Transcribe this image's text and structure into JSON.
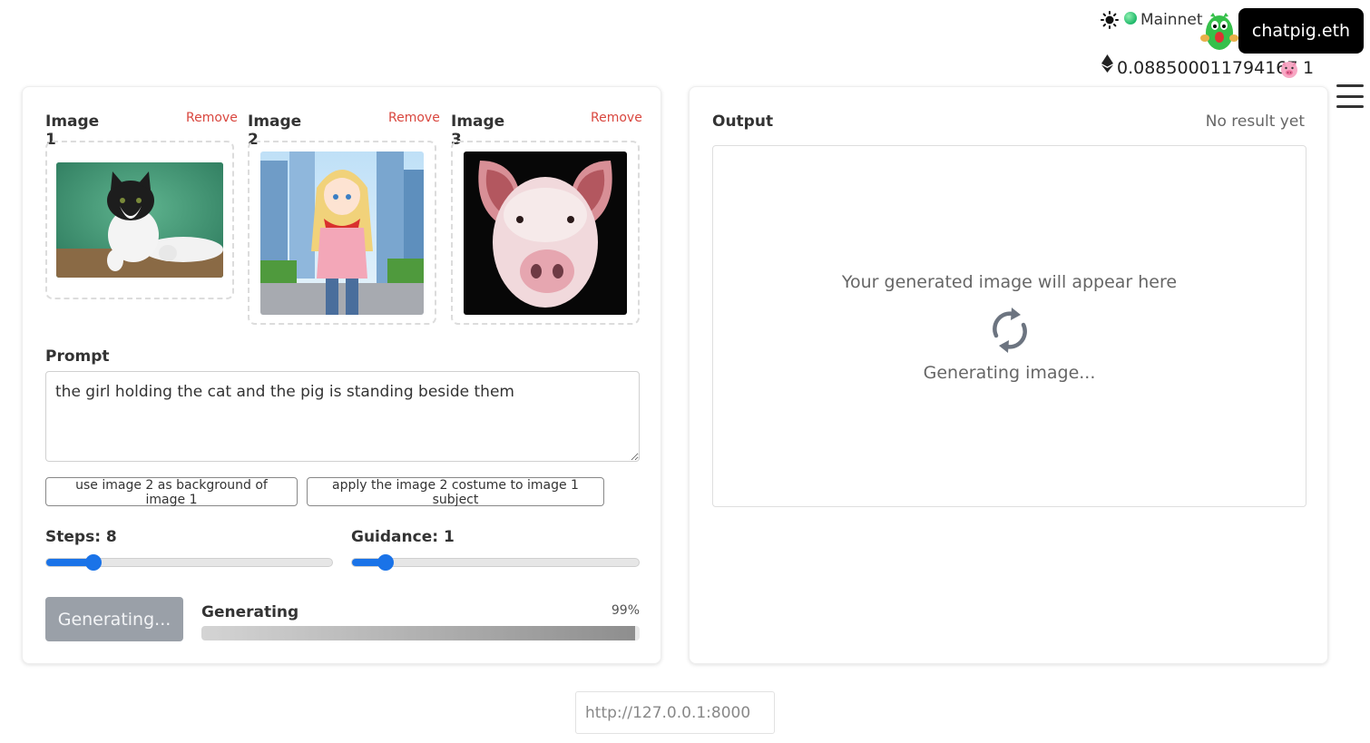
{
  "header": {
    "theme_icon": "sun-icon",
    "network_label": "Mainnet",
    "account_label": "chatpig.eth",
    "eth_icon": "ethereum-icon",
    "balance": "0.088500011794167",
    "token_icon": "pig-icon",
    "token_count": "1",
    "menu_icon": "hamburger-menu-icon"
  },
  "inputs": {
    "images": [
      {
        "label": "Image 1",
        "remove_label": "Remove",
        "content": "cat"
      },
      {
        "label": "Image 2",
        "remove_label": "Remove",
        "content": "anime-girl"
      },
      {
        "label": "Image 3",
        "remove_label": "Remove",
        "content": "pig"
      }
    ],
    "prompt_label": "Prompt",
    "prompt_value": "the girl holding the cat and the pig is standing beside them",
    "suggestions": [
      "use image 2 as background of image 1",
      "apply the image 2 costume to image 1 subject"
    ],
    "steps_label": "Steps: 8",
    "steps_value": 8,
    "guidance_label": "Guidance: 1",
    "guidance_value": 1,
    "generate_button": "Generating...",
    "progress_label": "Generating",
    "progress_pct": "99%",
    "progress_value": 0.99
  },
  "output": {
    "title": "Output",
    "status": "No result yet",
    "placeholder": "Your generated image will appear here",
    "generating_text": "Generating image..."
  },
  "footer": {
    "api_placeholder": "http://127.0.0.1:8000"
  },
  "colors": {
    "accent": "#1a73e8",
    "remove": "#d9473f",
    "account_bg": "#000000"
  }
}
